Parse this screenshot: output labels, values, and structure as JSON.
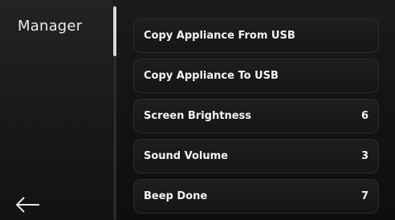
{
  "header": {
    "title": "Manager"
  },
  "nav": {
    "back_icon": "arrow-left-icon"
  },
  "menu": {
    "items": [
      {
        "label": "Copy Appliance From USB",
        "value": ""
      },
      {
        "label": "Copy Appliance To USB",
        "value": ""
      },
      {
        "label": "Screen Brightness",
        "value": "6"
      },
      {
        "label": "Sound Volume",
        "value": "3"
      },
      {
        "label": "Beep Done",
        "value": "7"
      }
    ]
  },
  "colors": {
    "background": "#121212",
    "item_background": "#1a1a1a",
    "text": "#f4f4f4",
    "scroll_thumb": "#d8d8d8"
  }
}
